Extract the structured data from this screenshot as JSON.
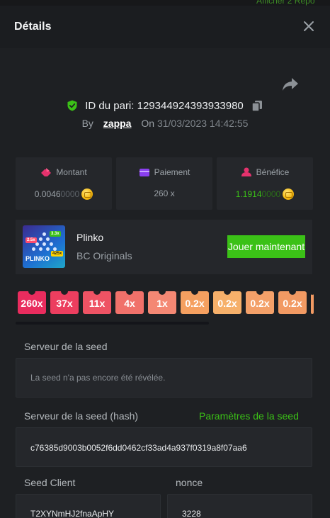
{
  "background_peek": "Afficher 2 Répo",
  "header": {
    "title": "Détails"
  },
  "bet": {
    "id_label": "ID du pari: 129344924393933980",
    "by_label": "By",
    "username": "zappa",
    "on_label": "On",
    "datetime": "31/03/2023 14:42:55"
  },
  "stats": [
    {
      "label": "Montant",
      "value_main": "0.0046",
      "value_faded": "0000",
      "value_color": "#9aa0a6",
      "icon": "wager-icon",
      "icon_color": "#e5326d"
    },
    {
      "label": "Paiement",
      "value_main": "260 x",
      "value_faded": "",
      "value_color": "#9aa0a6",
      "icon": "wallet-icon",
      "icon_color": "#8a3ff0"
    },
    {
      "label": "Bénéfice",
      "value_main": "1.1914",
      "value_faded": "0000",
      "value_color": "#3bc117",
      "icon": "profit-icon",
      "icon_color": "#e5326d"
    }
  ],
  "game": {
    "name": "Plinko",
    "provider": "BC Originals",
    "play_label": "Jouer maintenant",
    "thumb_logo": "PLINKO",
    "thumb_tags": [
      "2.5x",
      "3.3x",
      "425x"
    ]
  },
  "multipliers": [
    {
      "label": "260x",
      "color": "#e92c5e"
    },
    {
      "label": "37x",
      "color": "#ec3e5f"
    },
    {
      "label": "11x",
      "color": "#ee5364"
    },
    {
      "label": "4x",
      "color": "#f0716a"
    },
    {
      "label": "1x",
      "color": "#f48874"
    },
    {
      "label": "0.2x",
      "color": "#f5a060"
    },
    {
      "label": "0.2x",
      "color": "#f6b06a"
    },
    {
      "label": "0.2x",
      "color": "#f3a069"
    },
    {
      "label": "0.2x",
      "color": "#f29a63"
    }
  ],
  "seed": {
    "server_label": "Serveur de la seed",
    "server_value": "La seed n'a pas encore été révélée.",
    "hash_label": "Serveur de la seed (hash)",
    "settings_link": "Paramètres de la seed",
    "hash_value": "c76385d9003b0052f6dd0462cf33ad4a937f0319a8f07aa6",
    "client_label": "Seed Client",
    "client_value": "T2XYNmHJ2fnaApHY",
    "nonce_label": "nonce",
    "nonce_value": "3228"
  },
  "colors": {
    "accent_green": "#3bc117",
    "panel": "#25272b",
    "background": "#1e2023"
  }
}
